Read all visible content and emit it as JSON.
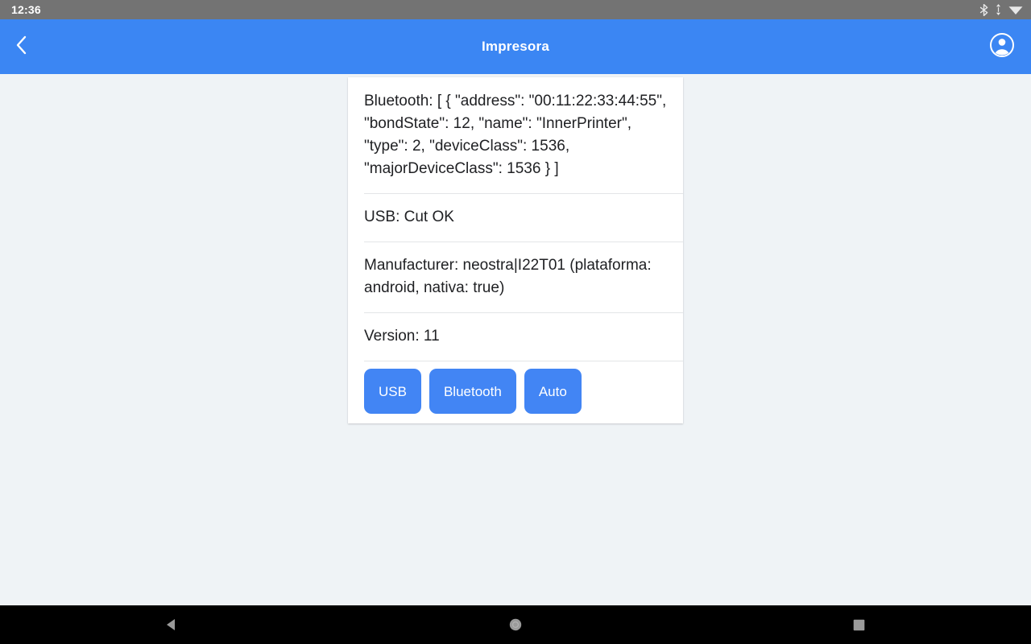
{
  "status_bar": {
    "clock": "12:36",
    "icons": [
      "bluetooth-icon",
      "data-transfer-icon",
      "wifi-icon"
    ],
    "background": "#737373"
  },
  "app_bar": {
    "title": "Impresora",
    "back_icon": "chevron-left-icon",
    "account_icon": "account-circle-icon",
    "background": "#3b86f3"
  },
  "card": {
    "rows": [
      {
        "name": "bluetooth-info",
        "text": "Bluetooth: [ { \"address\": \"00:11:22:33:44:55\", \"bondState\": 12, \"name\": \"InnerPrinter\", \"type\": 2, \"deviceClass\": 1536, \"majorDeviceClass\": 1536 } ]"
      },
      {
        "name": "usb-status",
        "text": "USB: Cut OK"
      },
      {
        "name": "manufacturer-info",
        "text": "Manufacturer: neostra|I22T01 (plataforma: android, nativa: true)"
      },
      {
        "name": "version-info",
        "text": "Version: 11"
      }
    ],
    "buttons": [
      {
        "name": "usb-button",
        "label": "USB"
      },
      {
        "name": "bluetooth-button",
        "label": "Bluetooth"
      },
      {
        "name": "auto-button",
        "label": "Auto"
      }
    ],
    "button_color": "#4285f4",
    "background": "#ffffff"
  },
  "nav_bar": {
    "back_icon": "nav-back-triangle-icon",
    "home_icon": "nav-home-circle-icon",
    "recents_icon": "nav-recents-square-icon",
    "background": "#000000"
  }
}
